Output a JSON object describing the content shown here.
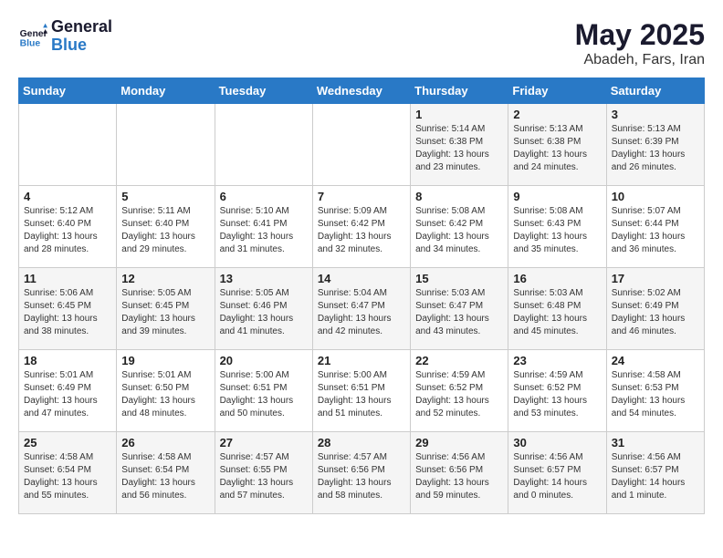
{
  "logo": {
    "line1": "General",
    "line2": "Blue"
  },
  "title": "May 2025",
  "subtitle": "Abadeh, Fars, Iran",
  "days_of_week": [
    "Sunday",
    "Monday",
    "Tuesday",
    "Wednesday",
    "Thursday",
    "Friday",
    "Saturday"
  ],
  "weeks": [
    [
      {
        "day": "",
        "content": ""
      },
      {
        "day": "",
        "content": ""
      },
      {
        "day": "",
        "content": ""
      },
      {
        "day": "",
        "content": ""
      },
      {
        "day": "1",
        "content": "Sunrise: 5:14 AM\nSunset: 6:38 PM\nDaylight: 13 hours\nand 23 minutes."
      },
      {
        "day": "2",
        "content": "Sunrise: 5:13 AM\nSunset: 6:38 PM\nDaylight: 13 hours\nand 24 minutes."
      },
      {
        "day": "3",
        "content": "Sunrise: 5:13 AM\nSunset: 6:39 PM\nDaylight: 13 hours\nand 26 minutes."
      }
    ],
    [
      {
        "day": "4",
        "content": "Sunrise: 5:12 AM\nSunset: 6:40 PM\nDaylight: 13 hours\nand 28 minutes."
      },
      {
        "day": "5",
        "content": "Sunrise: 5:11 AM\nSunset: 6:40 PM\nDaylight: 13 hours\nand 29 minutes."
      },
      {
        "day": "6",
        "content": "Sunrise: 5:10 AM\nSunset: 6:41 PM\nDaylight: 13 hours\nand 31 minutes."
      },
      {
        "day": "7",
        "content": "Sunrise: 5:09 AM\nSunset: 6:42 PM\nDaylight: 13 hours\nand 32 minutes."
      },
      {
        "day": "8",
        "content": "Sunrise: 5:08 AM\nSunset: 6:42 PM\nDaylight: 13 hours\nand 34 minutes."
      },
      {
        "day": "9",
        "content": "Sunrise: 5:08 AM\nSunset: 6:43 PM\nDaylight: 13 hours\nand 35 minutes."
      },
      {
        "day": "10",
        "content": "Sunrise: 5:07 AM\nSunset: 6:44 PM\nDaylight: 13 hours\nand 36 minutes."
      }
    ],
    [
      {
        "day": "11",
        "content": "Sunrise: 5:06 AM\nSunset: 6:45 PM\nDaylight: 13 hours\nand 38 minutes."
      },
      {
        "day": "12",
        "content": "Sunrise: 5:05 AM\nSunset: 6:45 PM\nDaylight: 13 hours\nand 39 minutes."
      },
      {
        "day": "13",
        "content": "Sunrise: 5:05 AM\nSunset: 6:46 PM\nDaylight: 13 hours\nand 41 minutes."
      },
      {
        "day": "14",
        "content": "Sunrise: 5:04 AM\nSunset: 6:47 PM\nDaylight: 13 hours\nand 42 minutes."
      },
      {
        "day": "15",
        "content": "Sunrise: 5:03 AM\nSunset: 6:47 PM\nDaylight: 13 hours\nand 43 minutes."
      },
      {
        "day": "16",
        "content": "Sunrise: 5:03 AM\nSunset: 6:48 PM\nDaylight: 13 hours\nand 45 minutes."
      },
      {
        "day": "17",
        "content": "Sunrise: 5:02 AM\nSunset: 6:49 PM\nDaylight: 13 hours\nand 46 minutes."
      }
    ],
    [
      {
        "day": "18",
        "content": "Sunrise: 5:01 AM\nSunset: 6:49 PM\nDaylight: 13 hours\nand 47 minutes."
      },
      {
        "day": "19",
        "content": "Sunrise: 5:01 AM\nSunset: 6:50 PM\nDaylight: 13 hours\nand 48 minutes."
      },
      {
        "day": "20",
        "content": "Sunrise: 5:00 AM\nSunset: 6:51 PM\nDaylight: 13 hours\nand 50 minutes."
      },
      {
        "day": "21",
        "content": "Sunrise: 5:00 AM\nSunset: 6:51 PM\nDaylight: 13 hours\nand 51 minutes."
      },
      {
        "day": "22",
        "content": "Sunrise: 4:59 AM\nSunset: 6:52 PM\nDaylight: 13 hours\nand 52 minutes."
      },
      {
        "day": "23",
        "content": "Sunrise: 4:59 AM\nSunset: 6:52 PM\nDaylight: 13 hours\nand 53 minutes."
      },
      {
        "day": "24",
        "content": "Sunrise: 4:58 AM\nSunset: 6:53 PM\nDaylight: 13 hours\nand 54 minutes."
      }
    ],
    [
      {
        "day": "25",
        "content": "Sunrise: 4:58 AM\nSunset: 6:54 PM\nDaylight: 13 hours\nand 55 minutes."
      },
      {
        "day": "26",
        "content": "Sunrise: 4:58 AM\nSunset: 6:54 PM\nDaylight: 13 hours\nand 56 minutes."
      },
      {
        "day": "27",
        "content": "Sunrise: 4:57 AM\nSunset: 6:55 PM\nDaylight: 13 hours\nand 57 minutes."
      },
      {
        "day": "28",
        "content": "Sunrise: 4:57 AM\nSunset: 6:56 PM\nDaylight: 13 hours\nand 58 minutes."
      },
      {
        "day": "29",
        "content": "Sunrise: 4:56 AM\nSunset: 6:56 PM\nDaylight: 13 hours\nand 59 minutes."
      },
      {
        "day": "30",
        "content": "Sunrise: 4:56 AM\nSunset: 6:57 PM\nDaylight: 14 hours\nand 0 minutes."
      },
      {
        "day": "31",
        "content": "Sunrise: 4:56 AM\nSunset: 6:57 PM\nDaylight: 14 hours\nand 1 minute."
      }
    ]
  ]
}
